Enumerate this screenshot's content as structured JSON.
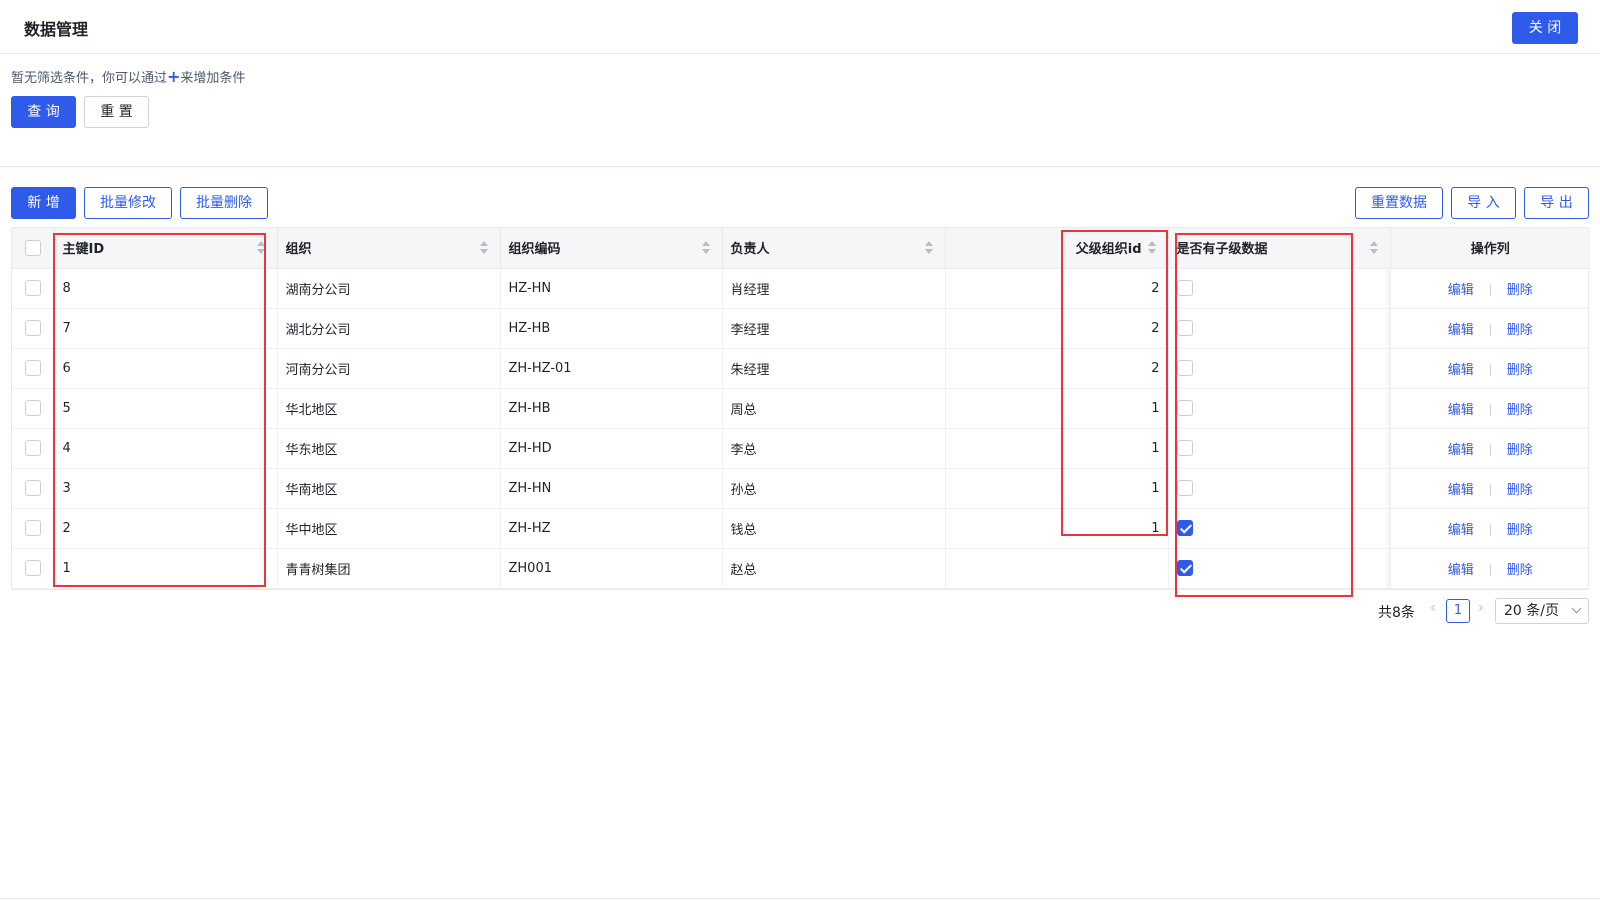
{
  "header": {
    "title": "数据管理",
    "close_label": "关 闭"
  },
  "filter": {
    "hint_prefix": "暂无筛选条件，你可以通过",
    "hint_plus": "+",
    "hint_suffix": "来增加条件",
    "query_label": "查 询",
    "reset_label": "重 置"
  },
  "toolbar": {
    "add_label": "新 增",
    "batch_edit_label": "批量修改",
    "batch_delete_label": "批量删除",
    "reset_data_label": "重置数据",
    "import_label": "导 入",
    "export_label": "导 出"
  },
  "table": {
    "columns": [
      "主键ID",
      "组织",
      "组织编码",
      "负责人",
      "父级组织id",
      "是否有子级数据",
      "操作列"
    ],
    "rows": [
      {
        "id": "8",
        "org": "湖南分公司",
        "code": "HZ-HN",
        "owner": "肖经理",
        "parent": "2",
        "has_child": false
      },
      {
        "id": "7",
        "org": "湖北分公司",
        "code": "HZ-HB",
        "owner": "李经理",
        "parent": "2",
        "has_child": false
      },
      {
        "id": "6",
        "org": "河南分公司",
        "code": "ZH-HZ-01",
        "owner": "朱经理",
        "parent": "2",
        "has_child": false
      },
      {
        "id": "5",
        "org": "华北地区",
        "code": "ZH-HB",
        "owner": "周总",
        "parent": "1",
        "has_child": false
      },
      {
        "id": "4",
        "org": "华东地区",
        "code": "ZH-HD",
        "owner": "李总",
        "parent": "1",
        "has_child": false
      },
      {
        "id": "3",
        "org": "华南地区",
        "code": "ZH-HN",
        "owner": "孙总",
        "parent": "1",
        "has_child": false
      },
      {
        "id": "2",
        "org": "华中地区",
        "code": "ZH-HZ",
        "owner": "钱总",
        "parent": "1",
        "has_child": true
      },
      {
        "id": "1",
        "org": "青青树集团",
        "code": "ZH001",
        "owner": "赵总",
        "parent": "",
        "has_child": true
      }
    ],
    "edit_label": "编辑",
    "delete_label": "删除"
  },
  "pagination": {
    "total_label": "共8条",
    "current_page": "1",
    "page_size_label": "20 条/页"
  },
  "colors": {
    "primary": "#2f5bea",
    "highlight": "#e8363a"
  }
}
